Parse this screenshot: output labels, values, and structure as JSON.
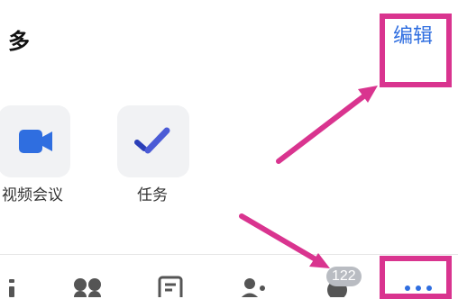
{
  "header": {
    "title": "多",
    "edit_label": "编辑"
  },
  "apps": [
    {
      "label": "视频会议",
      "icon": "video-camera-icon"
    },
    {
      "label": "任务",
      "icon": "task-check-icon"
    }
  ],
  "tabbar": {
    "icons": [
      "info-icon",
      "apps-grid-icon",
      "document-icon",
      "contacts-icon",
      "messages-icon",
      "more-icon"
    ],
    "badge": "122"
  },
  "colors": {
    "accent": "#2f6ee0",
    "annotation": "#d9348f",
    "tile_bg": "#f1f2f4"
  }
}
